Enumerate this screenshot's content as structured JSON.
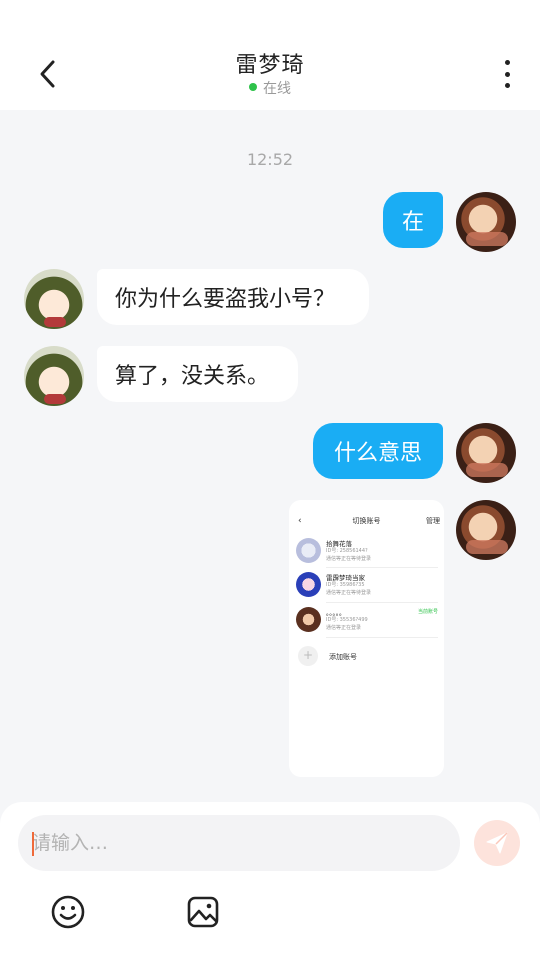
{
  "header": {
    "title": "雷梦琦",
    "status": "在线",
    "status_color": "#2ec24a",
    "back_icon": "chevron-left-icon",
    "more_icon": "more-vertical-icon"
  },
  "chat": {
    "timestamp": "12:52",
    "messages": [
      {
        "sender": "me",
        "text": "在"
      },
      {
        "sender": "them",
        "text": "你为什么要盗我小号？"
      },
      {
        "sender": "them",
        "text": "算了，没关系。"
      },
      {
        "sender": "me",
        "text": "什么意思"
      },
      {
        "sender": "me",
        "type": "image"
      }
    ],
    "bubble_color_me": "#1aadf4",
    "bubble_color_them": "#ffffff"
  },
  "image_message": {
    "title": "切换账号",
    "manage": "管理",
    "accounts": [
      {
        "name": "拾舞花落",
        "line1": "ID号: 25856144?",
        "line2": "通信等正在等待登录"
      },
      {
        "name": "雷霹梦琦当家",
        "line1": "ID号: 35986?35",
        "line2": "通信等正在等待登录"
      },
      {
        "name": "。。。。。",
        "line1": "ID号: 35536?499",
        "line2": "通信等正在登录",
        "tag": "当前账号"
      }
    ],
    "add_label": "添加账号"
  },
  "input": {
    "placeholder": "请输入…",
    "value": "",
    "send_icon": "send-icon",
    "emoji_icon": "emoji-icon",
    "image_icon": "image-icon"
  }
}
